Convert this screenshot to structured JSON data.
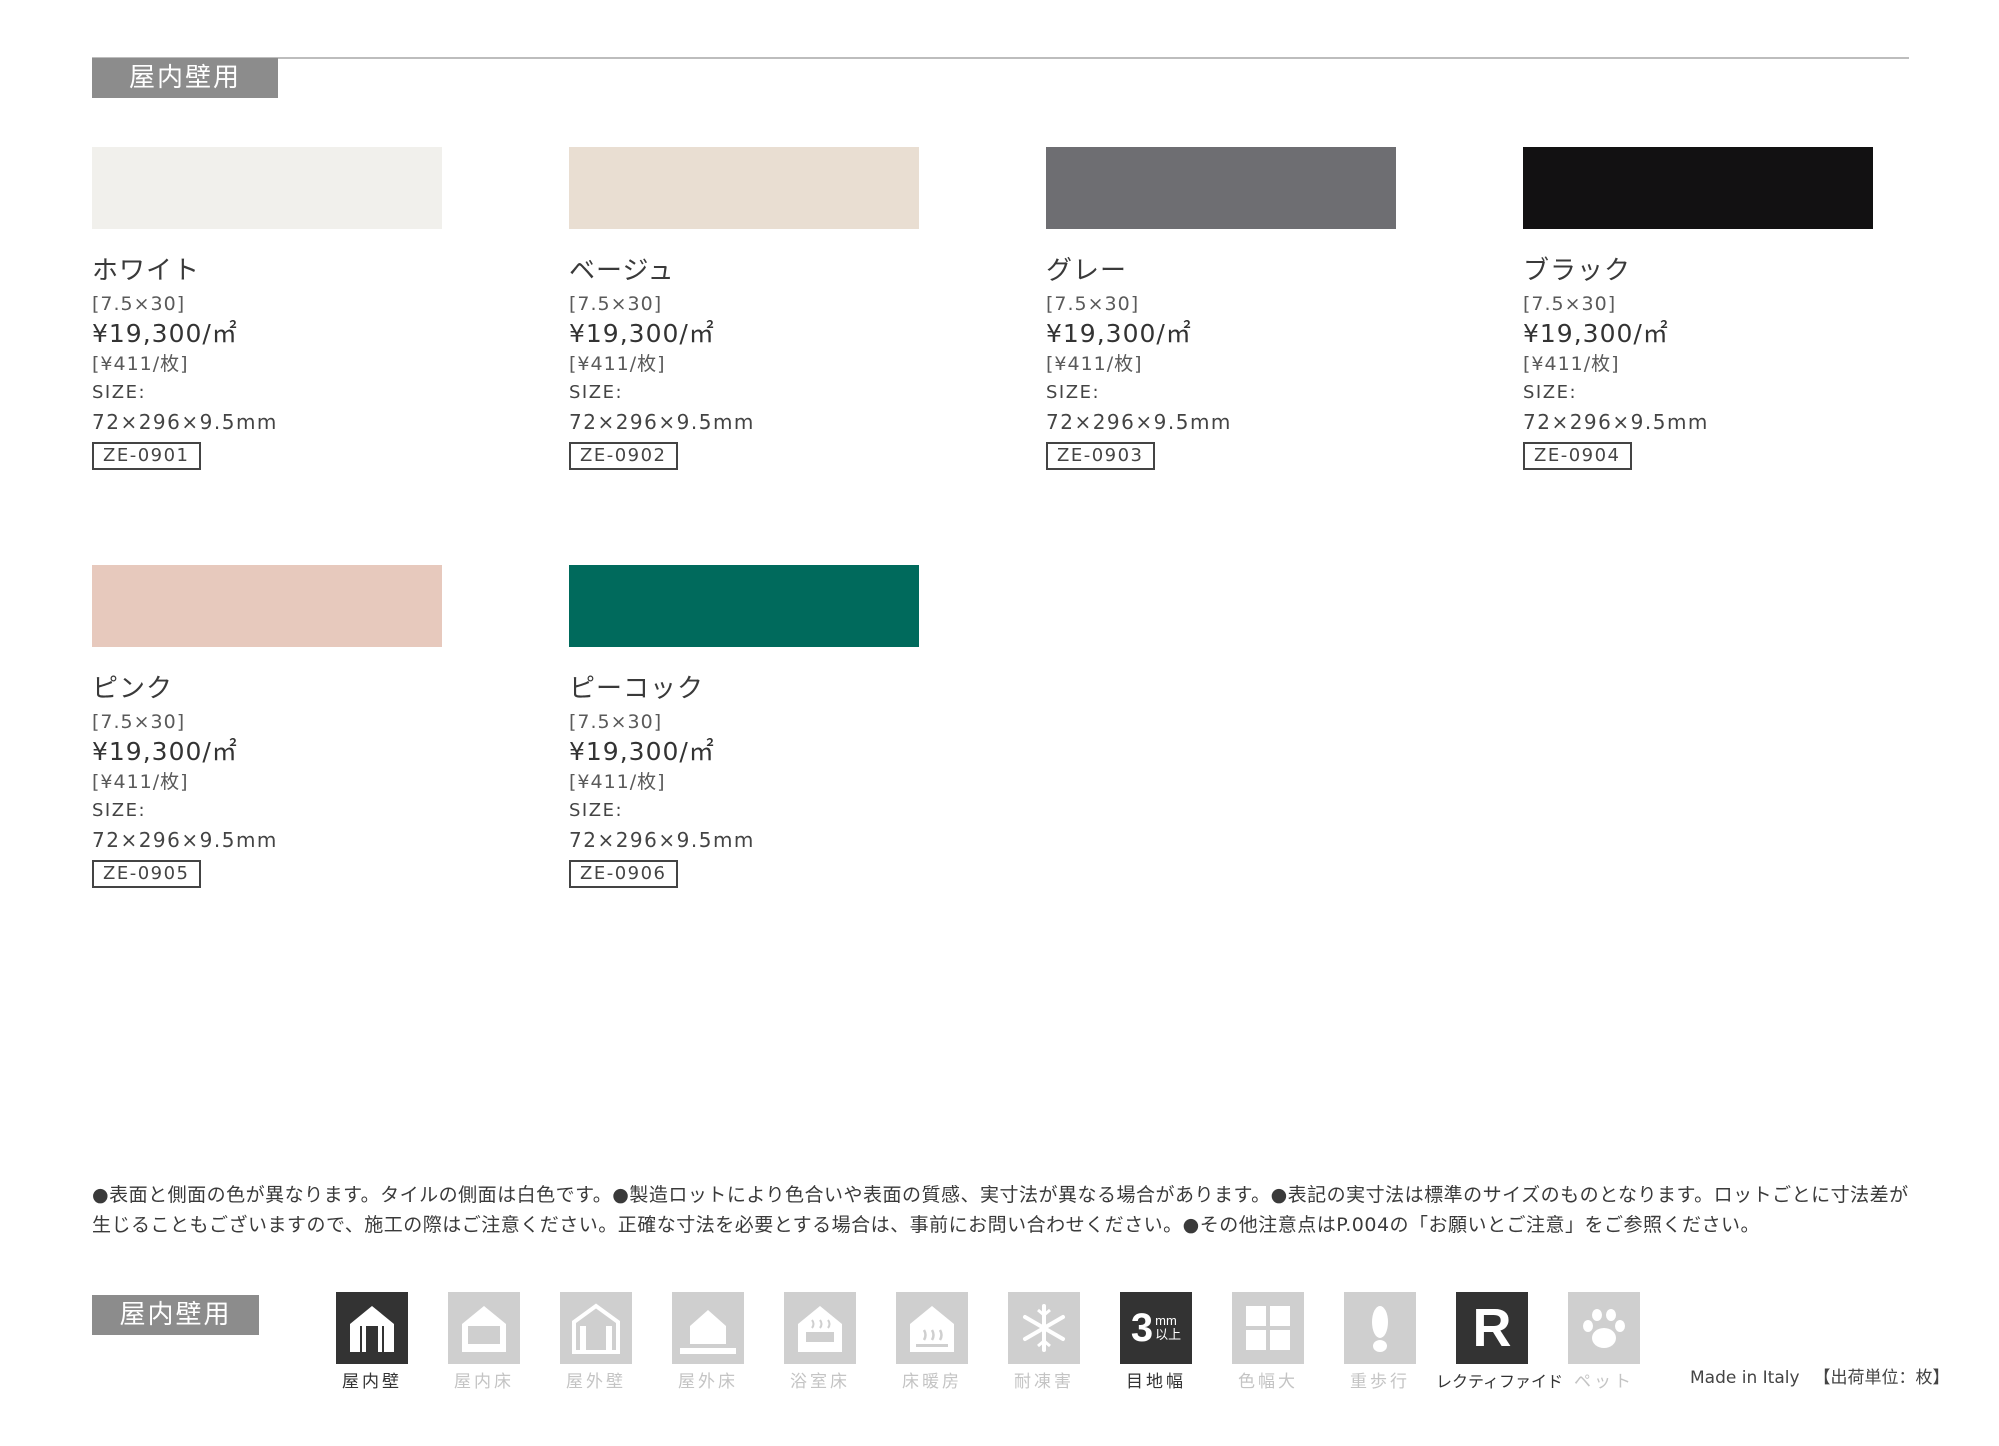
{
  "section_label": "屋内壁用",
  "products": [
    {
      "name": "ホワイト",
      "size_inch": "[7.5×30]",
      "price_m2": "¥19,300/㎡",
      "price_piece": "[¥411/枚]",
      "size_label": "SIZE:",
      "size_value": "72×296×9.5mm",
      "code": "ZE-0901",
      "color": "#f1f0ec"
    },
    {
      "name": "ベージュ",
      "size_inch": "[7.5×30]",
      "price_m2": "¥19,300/㎡",
      "price_piece": "[¥411/枚]",
      "size_label": "SIZE:",
      "size_value": "72×296×9.5mm",
      "code": "ZE-0902",
      "color": "#e9ded2"
    },
    {
      "name": "グレー",
      "size_inch": "[7.5×30]",
      "price_m2": "¥19,300/㎡",
      "price_piece": "[¥411/枚]",
      "size_label": "SIZE:",
      "size_value": "72×296×9.5mm",
      "code": "ZE-0903",
      "color": "#6e6e72"
    },
    {
      "name": "ブラック",
      "size_inch": "[7.5×30]",
      "price_m2": "¥19,300/㎡",
      "price_piece": "[¥411/枚]",
      "size_label": "SIZE:",
      "size_value": "72×296×9.5mm",
      "code": "ZE-0904",
      "color": "#121112"
    },
    {
      "name": "ピンク",
      "size_inch": "[7.5×30]",
      "price_m2": "¥19,300/㎡",
      "price_piece": "[¥411/枚]",
      "size_label": "SIZE:",
      "size_value": "72×296×9.5mm",
      "code": "ZE-0905",
      "color": "#e7c9bd"
    },
    {
      "name": "ピーコック",
      "size_inch": "[7.5×30]",
      "price_m2": "¥19,300/㎡",
      "price_piece": "[¥411/枚]",
      "size_label": "SIZE:",
      "size_value": "72×296×9.5mm",
      "code": "ZE-0906",
      "color": "#006a5c"
    }
  ],
  "notes": [
    "●表面と側面の色が異なります。タイルの側面は白色です。●製造ロットにより色合いや表面の質感、実寸法が異なる場合があります。●表記の実寸法は標準のサイズのものとなります。ロットごとに寸法差が",
    "生じることもございますので、施工の際はご注意ください。正確な寸法を必要とする場合は、事前にお問い合わせください。●その他注意点はP.004の「お願いとご注意」をご参照ください。"
  ],
  "usage_label": "屋内壁用",
  "usage_icons": [
    {
      "label": "屋内壁",
      "icon": "indoor-wall-icon",
      "active": true
    },
    {
      "label": "屋内床",
      "icon": "indoor-floor-icon",
      "active": false
    },
    {
      "label": "屋外壁",
      "icon": "outdoor-wall-icon",
      "active": false
    },
    {
      "label": "屋外床",
      "icon": "outdoor-floor-icon",
      "active": false
    },
    {
      "label": "浴室床",
      "icon": "bathroom-floor-icon",
      "active": false
    },
    {
      "label": "床暖房",
      "icon": "floor-heating-icon",
      "active": false
    },
    {
      "label": "耐凍害",
      "icon": "frost-resistance-icon",
      "active": false
    },
    {
      "label": "目地幅",
      "icon": "joint-width-icon",
      "active": true,
      "big": "3",
      "small_top": "mm",
      "small_bottom": "以上"
    },
    {
      "label": "色幅大",
      "icon": "color-variation-icon",
      "active": false
    },
    {
      "label": "重歩行",
      "icon": "heavy-traffic-icon",
      "active": false
    },
    {
      "label": "レクティファイド",
      "icon": "rectified-icon",
      "active": true,
      "letter": "R"
    },
    {
      "label": "ペット",
      "icon": "pet-icon",
      "active": false
    }
  ],
  "made_in": "Made in Italy",
  "shipping_unit": "【出荷単位：枚】",
  "colors": {
    "label_bg": "#8c8c8c",
    "icon_on": "#333333",
    "icon_off": "#cfcfcf"
  }
}
